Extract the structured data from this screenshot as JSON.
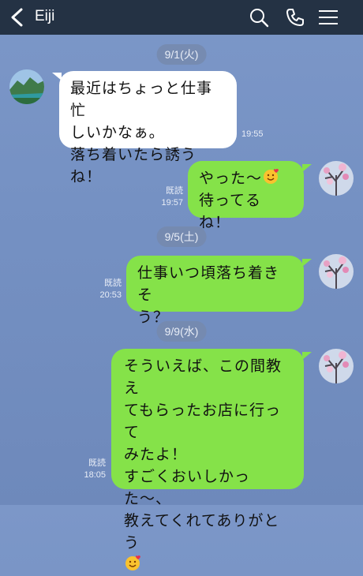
{
  "header": {
    "contact_name": "Eiji"
  },
  "dates": [
    "9/1(火)",
    "9/5(土)",
    "9/9(水)"
  ],
  "messages": [
    {
      "line1": "最近はちょっと仕事忙",
      "line2": "しいかなぁ。",
      "line3": "落ち着いたら誘うね！",
      "time": "19:55"
    },
    {
      "line1": "やった〜",
      "line2": "待ってるね！",
      "read": "既読",
      "time": "19:57"
    },
    {
      "line1": "仕事いつ頃落ち着きそ",
      "line2": "う？",
      "read": "既読",
      "time": "20:53"
    },
    {
      "line1": "そういえば、この間教え",
      "line2": "てもらったお店に行って",
      "line3": "みたよ！",
      "line4": "すごくおいしかった〜、",
      "line5": "教えてくれてありがとう",
      "read": "既読",
      "time": "18:05"
    }
  ],
  "icons": {
    "back": "chevron-left-icon",
    "search": "search-icon",
    "call": "phone-icon",
    "menu": "hamburger-menu-icon",
    "emoji": "smiling-face-with-hearts-emoji"
  }
}
